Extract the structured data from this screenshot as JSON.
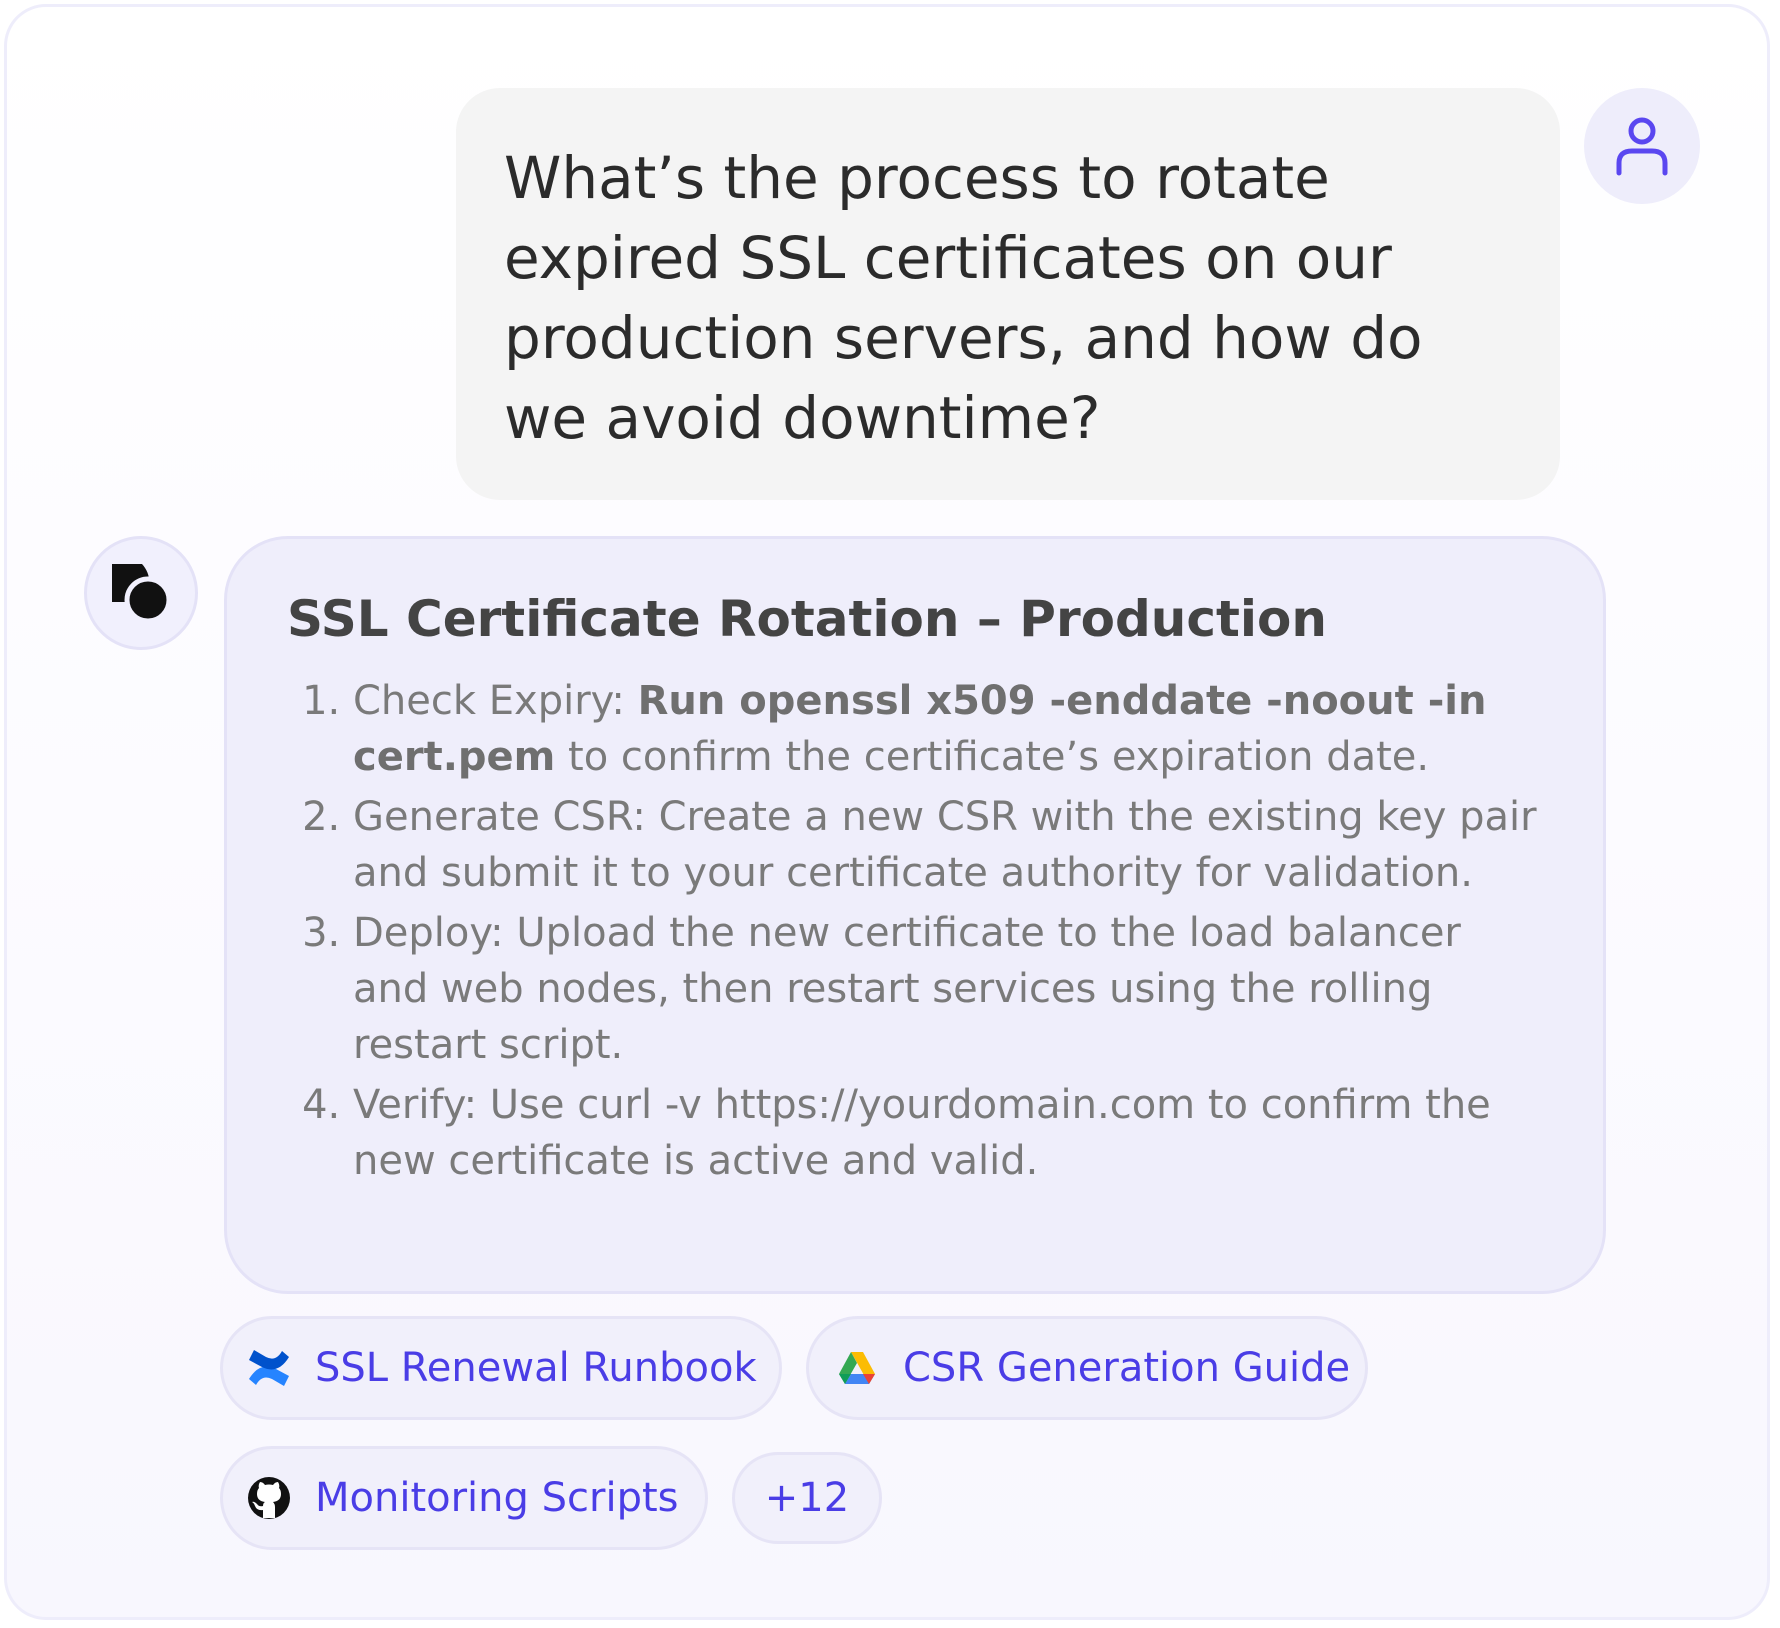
{
  "user_message": "What’s the process to rotate expired SSL certificates on our production servers, and how do we avoid downtime?",
  "answer": {
    "title": "SSL Certificate Rotation – Production",
    "steps": [
      {
        "pre": "Check Expiry: ",
        "cmd": "Run openssl x509 -enddate -noout -in cert.pem",
        "post": " to confirm the certificate’s expiration date."
      },
      {
        "pre": "Generate CSR: Create a new CSR with the existing key pair and submit it to your certificate authority for validation."
      },
      {
        "pre": "Deploy: Upload the new certificate to the load balancer and web nodes, then restart services using the rolling restart script."
      },
      {
        "pre": "Verify: Use curl -v https://yourdomain.com to confirm the new certificate is active and valid."
      }
    ]
  },
  "sources": [
    {
      "label": "SSL Renewal Runbook",
      "icon": "confluence-icon"
    },
    {
      "label": "CSR Generation Guide",
      "icon": "google-drive-icon"
    },
    {
      "label": "Monitoring Scripts",
      "icon": "github-icon"
    }
  ],
  "more_sources": "+12",
  "colors": {
    "accent": "#4a3de6",
    "user_bubble": "#f4f4f4",
    "bot_bubble": "#efeefb"
  }
}
